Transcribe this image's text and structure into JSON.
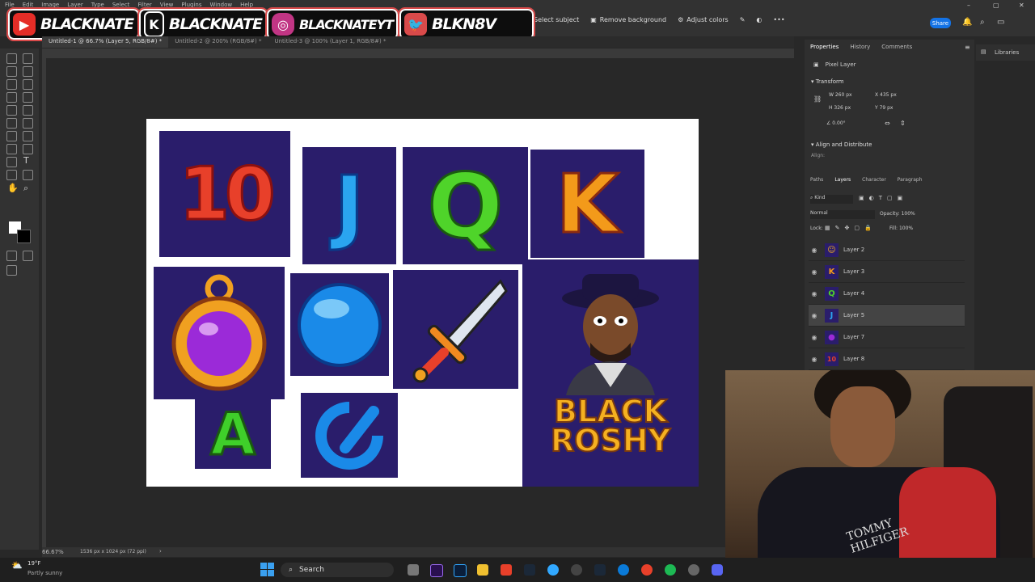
{
  "menu": [
    "File",
    "Edit",
    "Image",
    "Layer",
    "Type",
    "Select",
    "Filter",
    "View",
    "Plugins",
    "Window",
    "Help"
  ],
  "social": [
    {
      "icon": "youtube-icon",
      "text": "BLACKNATE",
      "color": "#e52d27"
    },
    {
      "icon": "kick-icon",
      "text": "BLACKNATE",
      "color": "#111111"
    },
    {
      "icon": "instagram-icon",
      "text": "BLACKNATEYT",
      "color": "#c13584"
    },
    {
      "icon": "twitter-icon",
      "text": "BLKN8V",
      "color": "#d94a4a"
    }
  ],
  "options": {
    "select_subject": "Select subject",
    "remove_background": "Remove background",
    "adjust_colors": "Adjust colors",
    "share": "Share"
  },
  "tabs": [
    "Untitled-1 @ 66.7% (Layer 5, RGB/8#) *",
    "Untitled-2 @ 200% (RGB/8#) *",
    "Untitled-3 @ 100% (Layer 1, RGB/8#) *"
  ],
  "canvas_tiles": [
    {
      "label": "10",
      "color": "#e8402a"
    },
    {
      "label": "J",
      "color": "#2aa5f0"
    },
    {
      "label": "Q",
      "color": "#4fd42a"
    },
    {
      "label": "K",
      "color": "#f39a1a"
    },
    {
      "label": "A",
      "color": "#3fcf2a"
    }
  ],
  "character_text": {
    "line1": "BLACK",
    "line2": "ROSHY"
  },
  "status": {
    "zoom": "66.67%",
    "doc_size": "1536 px x 1024 px (72 ppi)"
  },
  "properties": {
    "tabs": [
      "Properties",
      "History",
      "Comments"
    ],
    "kind": "Pixel Layer",
    "transform_title": "Transform",
    "w": "260 px",
    "h": "326 px",
    "x": "435 px",
    "y": "79 px",
    "angle": "0.00°",
    "align_title": "Align and Distribute",
    "align_label": "Align:"
  },
  "libraries": "Libraries",
  "layers_panel": {
    "tabs": [
      "Paths",
      "Layers",
      "Character",
      "Paragraph"
    ],
    "kind": "Kind",
    "blend": "Normal",
    "opacity_label": "Opacity:",
    "opacity": "100%",
    "lock_label": "Lock:",
    "fill_label": "Fill:",
    "fill": "100%",
    "layers": [
      {
        "name": "Layer 2",
        "thumb": "☺",
        "color": "#2a1d6b",
        "selected": false
      },
      {
        "name": "Layer 3",
        "thumb": "K",
        "color": "#f39a1a",
        "selected": false
      },
      {
        "name": "Layer 4",
        "thumb": "Q",
        "color": "#4fd42a",
        "selected": false
      },
      {
        "name": "Layer 5",
        "thumb": "J",
        "color": "#2aa5f0",
        "selected": true
      },
      {
        "name": "Layer 7",
        "thumb": "●",
        "color": "#9b2ad8",
        "selected": false
      },
      {
        "name": "Layer 8",
        "thumb": "10",
        "color": "#e8402a",
        "selected": false
      }
    ]
  },
  "weather": {
    "temp": "19°F",
    "desc": "Partly sunny"
  },
  "taskbar": {
    "search": "Search"
  },
  "webcam": {
    "shirt_text": "TOMMY HILFIGER"
  }
}
